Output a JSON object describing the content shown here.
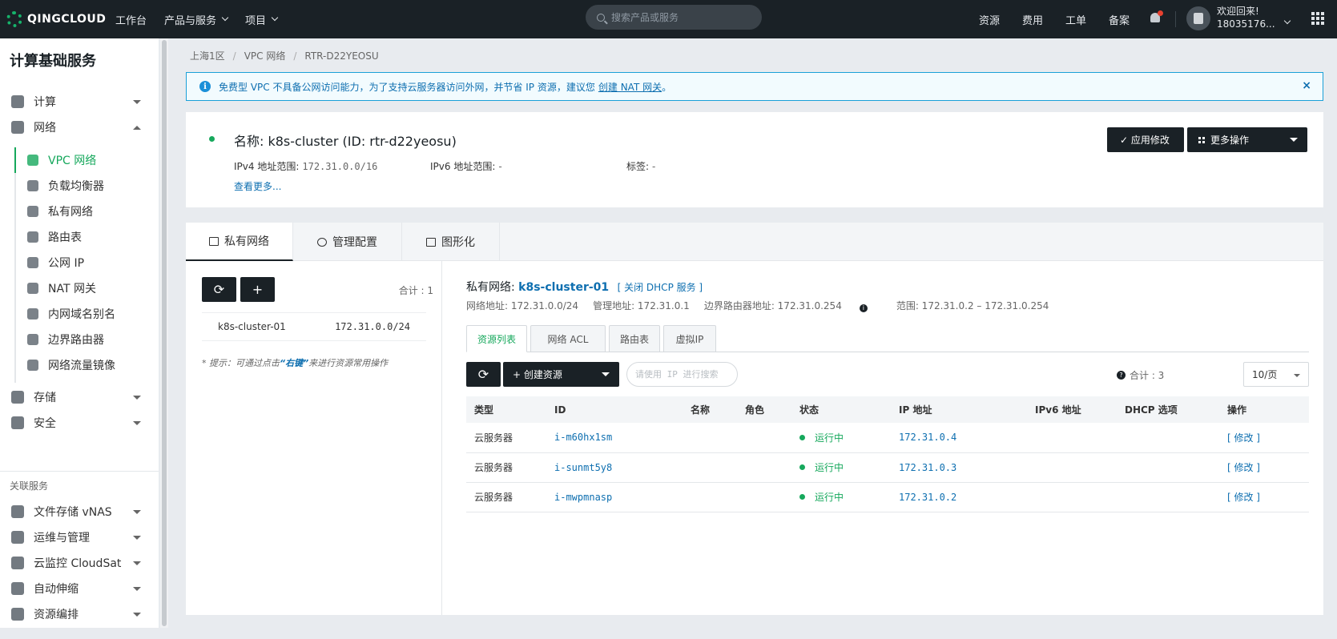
{
  "topbar": {
    "logo": "QINGCLOUD",
    "nav": [
      "工作台",
      "产品与服务",
      "项目"
    ],
    "search_placeholder": "搜索产品或服务",
    "right_links": [
      "资源",
      "费用",
      "工单",
      "备案"
    ],
    "welcome": "欢迎回来!",
    "user_id": "18035176..."
  },
  "sidebar": {
    "title": "计算基础服务",
    "groups": [
      {
        "label": "计算"
      },
      {
        "label": "网络"
      }
    ],
    "network_items": [
      {
        "label": "VPC 网络"
      },
      {
        "label": "负载均衡器"
      },
      {
        "label": "私有网络"
      },
      {
        "label": "路由表"
      },
      {
        "label": "公网 IP"
      },
      {
        "label": "NAT 网关"
      },
      {
        "label": "内网域名别名"
      },
      {
        "label": "边界路由器"
      },
      {
        "label": "网络流量镜像"
      }
    ],
    "groups2": [
      {
        "label": "存储"
      },
      {
        "label": "安全"
      }
    ],
    "related_title": "关联服务",
    "related": [
      {
        "label": "文件存储 vNAS"
      },
      {
        "label": "运维与管理"
      },
      {
        "label": "云监控 CloudSat"
      },
      {
        "label": "自动伸缩"
      },
      {
        "label": "资源编排"
      }
    ]
  },
  "breadcrumb": [
    "上海1区",
    "VPC 网络",
    "RTR-D22YEOSU"
  ],
  "alert": {
    "text": "免费型 VPC 不具备公网访问能力，为了支持云服务器访问外网，并节省 IP 资源，建议您",
    "link": "创建 NAT 网关",
    "end": "。",
    "close": "×"
  },
  "vpc": {
    "title": "名称: k8s-cluster (ID: rtr-d22yeosu)",
    "ipv4_label": "IPv4 地址范围:",
    "ipv4_value": "172.31.0.0/16",
    "ipv6_label": "IPv6 地址范围:",
    "ipv6_value": "-",
    "tag_label": "标签:",
    "tag_value": "-",
    "more": "查看更多...",
    "apply_btn": "✓ 应用修改",
    "more_btn": "更多操作"
  },
  "main_tabs": [
    "私有网络",
    "管理配置",
    "图形化"
  ],
  "left_list": {
    "refresh": "⟳",
    "add": "+",
    "total": "合计 : 1",
    "rows": [
      {
        "name": "k8s-cluster-01",
        "cidr": "172.31.0.0/24"
      }
    ],
    "hint_pre": "* 提示：可通过点击",
    "hint_key": "“右键”",
    "hint_post": "来进行资源常用操作"
  },
  "network": {
    "label": "私有网络:",
    "name": "k8s-cluster-01",
    "dhcp": "[ 关闭 DHCP 服务 ]",
    "addr": "网络地址: 172.31.0.0/24",
    "mgmt": "管理地址: 172.31.0.1",
    "border": "边界路由器地址: 172.31.0.254",
    "range": "范围: 172.31.0.2 – 172.31.0.254"
  },
  "sub_tabs": [
    "资源列表",
    "网络 ACL",
    "路由表",
    "虚拟IP"
  ],
  "resources": {
    "refresh": "⟳",
    "create": "+ 创建资源",
    "search_placeholder": "请使用 IP 进行搜索",
    "total": "合计 : 3",
    "page_size": "10/页",
    "columns": [
      "类型",
      "ID",
      "名称",
      "角色",
      "状态",
      "IP 地址",
      "IPv6 地址",
      "DHCP 选项",
      "操作"
    ],
    "rows": [
      {
        "type": "云服务器",
        "id": "i-m60hx1sm",
        "status": "运行中",
        "ip": "172.31.0.4",
        "action": "[ 修改 ]"
      },
      {
        "type": "云服务器",
        "id": "i-sunmt5y8",
        "status": "运行中",
        "ip": "172.31.0.3",
        "action": "[ 修改 ]"
      },
      {
        "type": "云服务器",
        "id": "i-mwpmnasp",
        "status": "运行中",
        "ip": "172.31.0.2",
        "action": "[ 修改 ]"
      }
    ]
  },
  "colors": {
    "accent": "#16a85c",
    "link": "#0e6fb0",
    "dark": "#1a2126"
  }
}
